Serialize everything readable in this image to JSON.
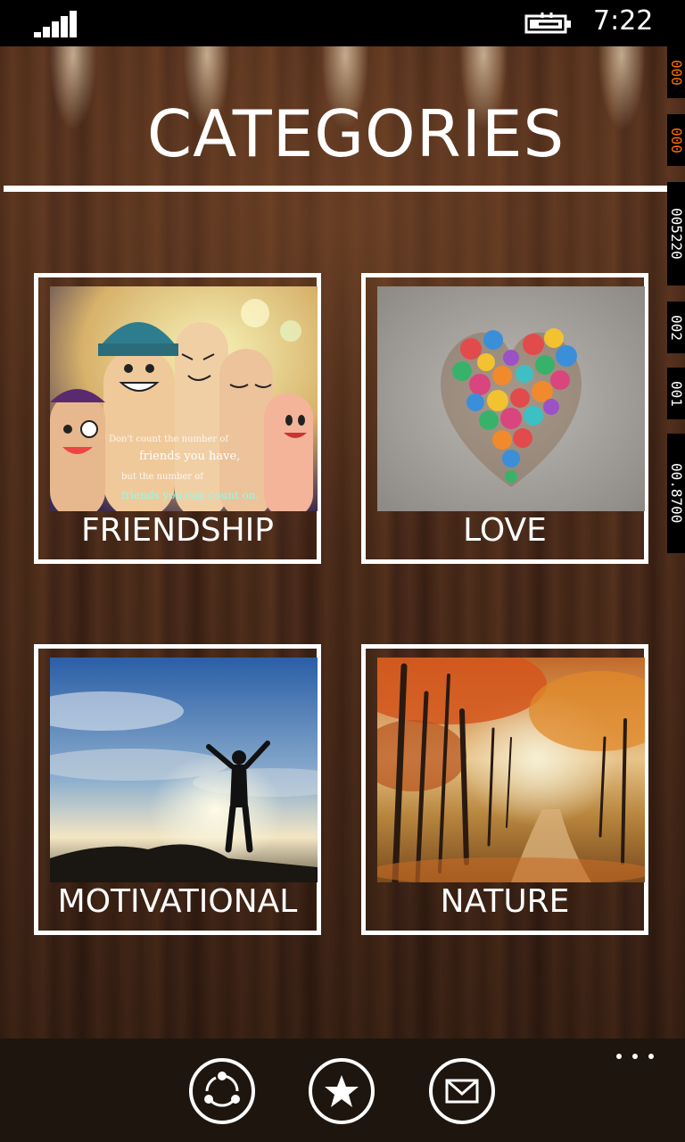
{
  "status_bar": {
    "time": "7:22",
    "signal_icon": "signal-strength-icon",
    "battery_icon": "battery-charging-icon"
  },
  "header": {
    "title": "CATEGORIES"
  },
  "debug_counters": [
    {
      "text": "000",
      "color": "#ff6a00"
    },
    {
      "text": "000",
      "color": "#ff6a00"
    },
    {
      "text": "005220",
      "color": "#ffffff"
    },
    {
      "text": "002",
      "color": "#ffffff"
    },
    {
      "text": "001",
      "color": "#ffffff"
    },
    {
      "text": "00.8700",
      "color": "#ffffff"
    }
  ],
  "categories": [
    {
      "label": "FRIENDSHIP",
      "image": "friendship-image"
    },
    {
      "label": "LOVE",
      "image": "love-heart-image"
    },
    {
      "label": "MOTIVATIONAL",
      "image": "motivational-image"
    },
    {
      "label": "NATURE",
      "image": "nature-image"
    }
  ],
  "friendship_quote": {
    "line1": "Don't count the number of",
    "line2": "friends you have,",
    "line3": "but the number of",
    "line4": "friends you can count on."
  },
  "app_bar": {
    "buttons": [
      {
        "icon": "share-icon"
      },
      {
        "icon": "star-icon"
      },
      {
        "icon": "mail-icon"
      }
    ],
    "more_icon": "ellipsis-icon"
  },
  "colors": {
    "tile_border": "#ffffff",
    "app_bar_bg": "#1e150e",
    "debug_orange": "#ff6a00"
  }
}
